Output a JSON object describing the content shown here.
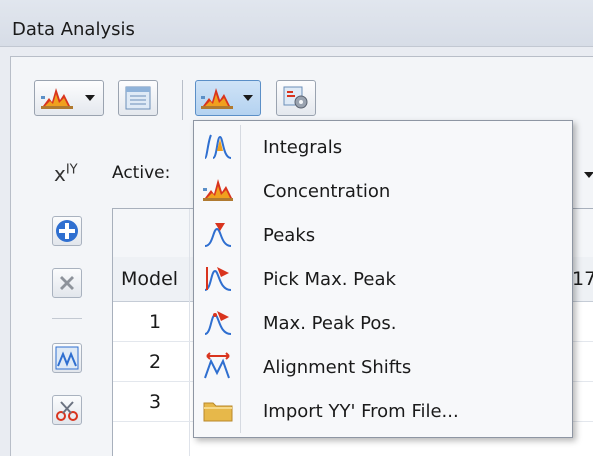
{
  "window": {
    "title": "Data Analysis"
  },
  "toolbar": {
    "icons": [
      "concentration-chart-icon",
      "table-view-icon",
      "concentration-chart-icon",
      "settings-icon"
    ]
  },
  "controls": {
    "xy_symbol": "x",
    "xy_sup": "IY",
    "active_label": "Active:"
  },
  "sidebar": {
    "icons": [
      "add-icon",
      "remove-icon",
      "alignment-shifts-icon",
      "cut-icon"
    ]
  },
  "table": {
    "header_col1": "Model",
    "header_partial": "17",
    "rows": [
      {
        "model": "1"
      },
      {
        "model": "2"
      },
      {
        "model": "3"
      }
    ]
  },
  "menu": {
    "items": [
      {
        "label": "Integrals",
        "icon": "integrals-icon"
      },
      {
        "label": "Concentration",
        "icon": "concentration-icon"
      },
      {
        "label": "Peaks",
        "icon": "peaks-icon"
      },
      {
        "label": "Pick Max. Peak",
        "icon": "pick-max-peak-icon"
      },
      {
        "label": "Max. Peak Pos.",
        "icon": "max-peak-pos-icon"
      },
      {
        "label": "Alignment Shifts",
        "icon": "alignment-shifts-icon"
      },
      {
        "label": "Import YY' From File...",
        "icon": "folder-icon"
      }
    ]
  },
  "colors": {
    "accent": "#5b8fc7",
    "chart_red": "#d9341e",
    "chart_orange": "#f0a01e"
  }
}
